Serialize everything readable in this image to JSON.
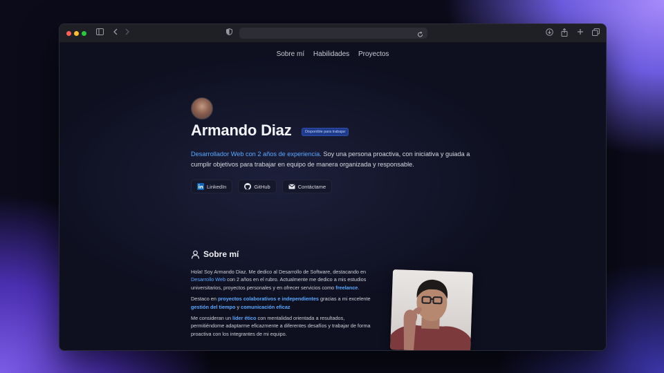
{
  "nav": {
    "items": [
      "Sobre mí",
      "Habilidades",
      "Proyectos"
    ]
  },
  "hero": {
    "name": "Armando Diaz",
    "badge": "Disponible para trabajar",
    "intro_highlight": "Desarrollador Web con 2 años de experiencia.",
    "intro_rest": " Soy una persona proactiva, con iniciativa y guiada a cumplir objetivos para trabajar en equipo de manera organizada y responsable."
  },
  "socials": [
    {
      "label": "LinkedIn",
      "icon": "linkedin-icon"
    },
    {
      "label": "GitHub",
      "icon": "github-icon"
    },
    {
      "label": "Contáctame",
      "icon": "mail-icon"
    }
  ],
  "about": {
    "title": "Sobre mí",
    "p1": {
      "a": "Hola! Soy Armando Diaz. Me dedico al Desarrollo de Software, destacando en ",
      "b": "Desarrollo Web",
      "c": " con 2 años en el rubro. Actualmente me dedico a mis estudios universitarios, proyectos personales y en ofrecer servicios como ",
      "d": "freelance",
      "e": "."
    },
    "p2": {
      "a": "Destaco en ",
      "b": "proyectos colaborativos e independientes",
      "c": " gracias a mi excelente ",
      "d": "gestión del tiempo",
      "e": " y ",
      "f": "comunicación eficaz"
    },
    "p3": {
      "a": "Me consideran un ",
      "b": "líder ético",
      "c": " con mentalidad orientada a resultados, permitiéndome adaptarme eficazmente a diferentes desafíos y trabajar de forma proactiva con los integrantes de mi equipo."
    }
  },
  "colors": {
    "accent": "#5aa8ff",
    "badge_bg": "#1e3a8a"
  }
}
